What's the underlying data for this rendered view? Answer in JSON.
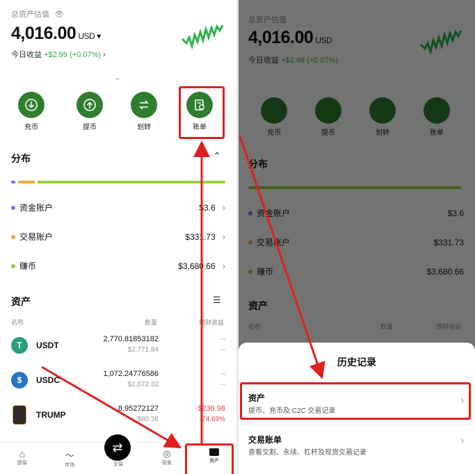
{
  "left": {
    "header_label": "总资产估值",
    "balance": "4,016.00",
    "currency": "USD",
    "today_label": "今日收益",
    "today_value": "+$2.99 (+0.07%)",
    "actions": [
      {
        "label": "充币",
        "icon": "deposit-icon"
      },
      {
        "label": "提币",
        "icon": "withdraw-icon"
      },
      {
        "label": "划转",
        "icon": "transfer-icon"
      },
      {
        "label": "账单",
        "icon": "bill-icon"
      }
    ],
    "distribution": {
      "title": "分布",
      "items": [
        {
          "label": "资金账户",
          "value": "$3.6",
          "color": "#7b6cf0"
        },
        {
          "label": "交易账户",
          "value": "$331.73",
          "color": "#f0a93a"
        },
        {
          "label": "赚币",
          "value": "$3,680.66",
          "color": "#9ad03c"
        }
      ]
    },
    "assets": {
      "title": "资产",
      "col_name": "名称",
      "col_qty": "数量",
      "col_pnl": "理财收益",
      "rows": [
        {
          "symbol": "USDT",
          "qty": "2,770.81853182",
          "value": "$2,771.84",
          "pnl": "--",
          "pnl_pct": "--"
        },
        {
          "symbol": "USDC",
          "qty": "1,072.24776586",
          "value": "$1,072.32",
          "pnl": "--",
          "pnl_pct": "--"
        },
        {
          "symbol": "TRUMP",
          "qty": "8.95272127",
          "value": "$80.38",
          "pnl": "-$236.98",
          "pnl_pct": "-74.69%"
        }
      ]
    },
    "nav": [
      {
        "label": "欧易",
        "icon": "home-icon"
      },
      {
        "label": "市场",
        "icon": "market-icon"
      },
      {
        "label": "交易",
        "icon": "trade-icon"
      },
      {
        "label": "探索",
        "icon": "explore-icon"
      },
      {
        "label": "资产",
        "icon": "assets-icon"
      }
    ]
  },
  "right": {
    "sheet_title": "历史记录",
    "options": [
      {
        "title": "资产",
        "subtitle": "提币、充币及 C2C 交易记录"
      },
      {
        "title": "交易账单",
        "subtitle": "查看交割、永续、杠杆及现货交易记录"
      }
    ]
  },
  "colors": {
    "accent_green": "#2f7d2f",
    "highlight_red": "#e02020",
    "loss_red": "#e0455c"
  }
}
